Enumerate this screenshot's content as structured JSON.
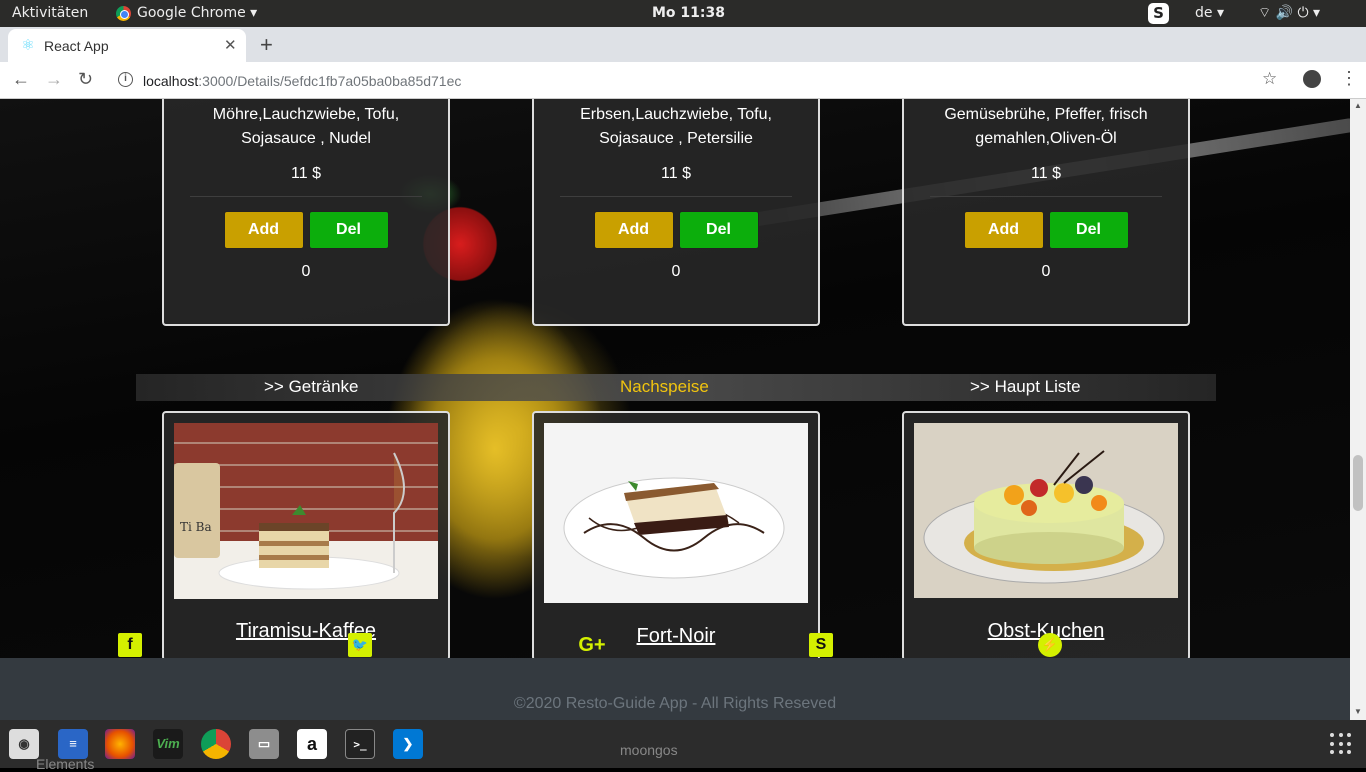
{
  "os": {
    "activities": "Aktivitäten",
    "app_menu": "Google Chrome ▾",
    "clock": "Mo 11:38",
    "skype_letter": "S",
    "language": "de ▾",
    "sys_icons": "⌔ 🔊 ⏻ ▾"
  },
  "browser": {
    "tab_title": "React App",
    "tab_close": "✕",
    "new_tab": "+",
    "url_host": "localhost",
    "url_rest": ":3000/Details/5efdc1fb7a05ba0ba85d71ec",
    "back": "←",
    "forward": "→",
    "reload": "↻",
    "star": "☆",
    "menu": "⋮"
  },
  "dishes": [
    {
      "desc": "Möhre,Lauchzwiebe, Tofu, Sojasauce , Nudel",
      "price": "11 $",
      "add": "Add",
      "del": "Del",
      "count": "0"
    },
    {
      "desc": "Erbsen,Lauchzwiebe, Tofu, Sojasauce , Petersilie",
      "price": "11 $",
      "add": "Add",
      "del": "Del",
      "count": "0"
    },
    {
      "desc": "Gemüsebrühe, Pfeffer, frisch gemahlen,Oliven-Öl",
      "price": "11 $",
      "add": "Add",
      "del": "Del",
      "count": "0"
    }
  ],
  "category_nav": {
    "left": ">> Getränke",
    "active": "Nachspeise",
    "right": ">> Haupt Liste"
  },
  "desserts": [
    {
      "name": "Tiramisu-Kaffee",
      "label_on_jar": "Ti Ba"
    },
    {
      "name": "Fort-Noir"
    },
    {
      "name": "Obst-Kuchen"
    }
  ],
  "social": {
    "facebook": "f",
    "twitter": "🐦",
    "google_plus": "G+",
    "skype": "S",
    "messenger": "⚡"
  },
  "footer": {
    "copyright": "©2020 Resto-Guide App - All Rights Reseved"
  },
  "dock": {
    "ghost_elements": "Elements",
    "ghost_moongos": "moongos",
    "vim": "Vim",
    "amazon": "a",
    "terminal": ">_"
  },
  "colors": {
    "add_button": "#c9a000",
    "del_button": "#0cae0c",
    "active_category": "#f1c40f",
    "social_accent": "#d4f000",
    "footer_bg": "#343a40"
  }
}
